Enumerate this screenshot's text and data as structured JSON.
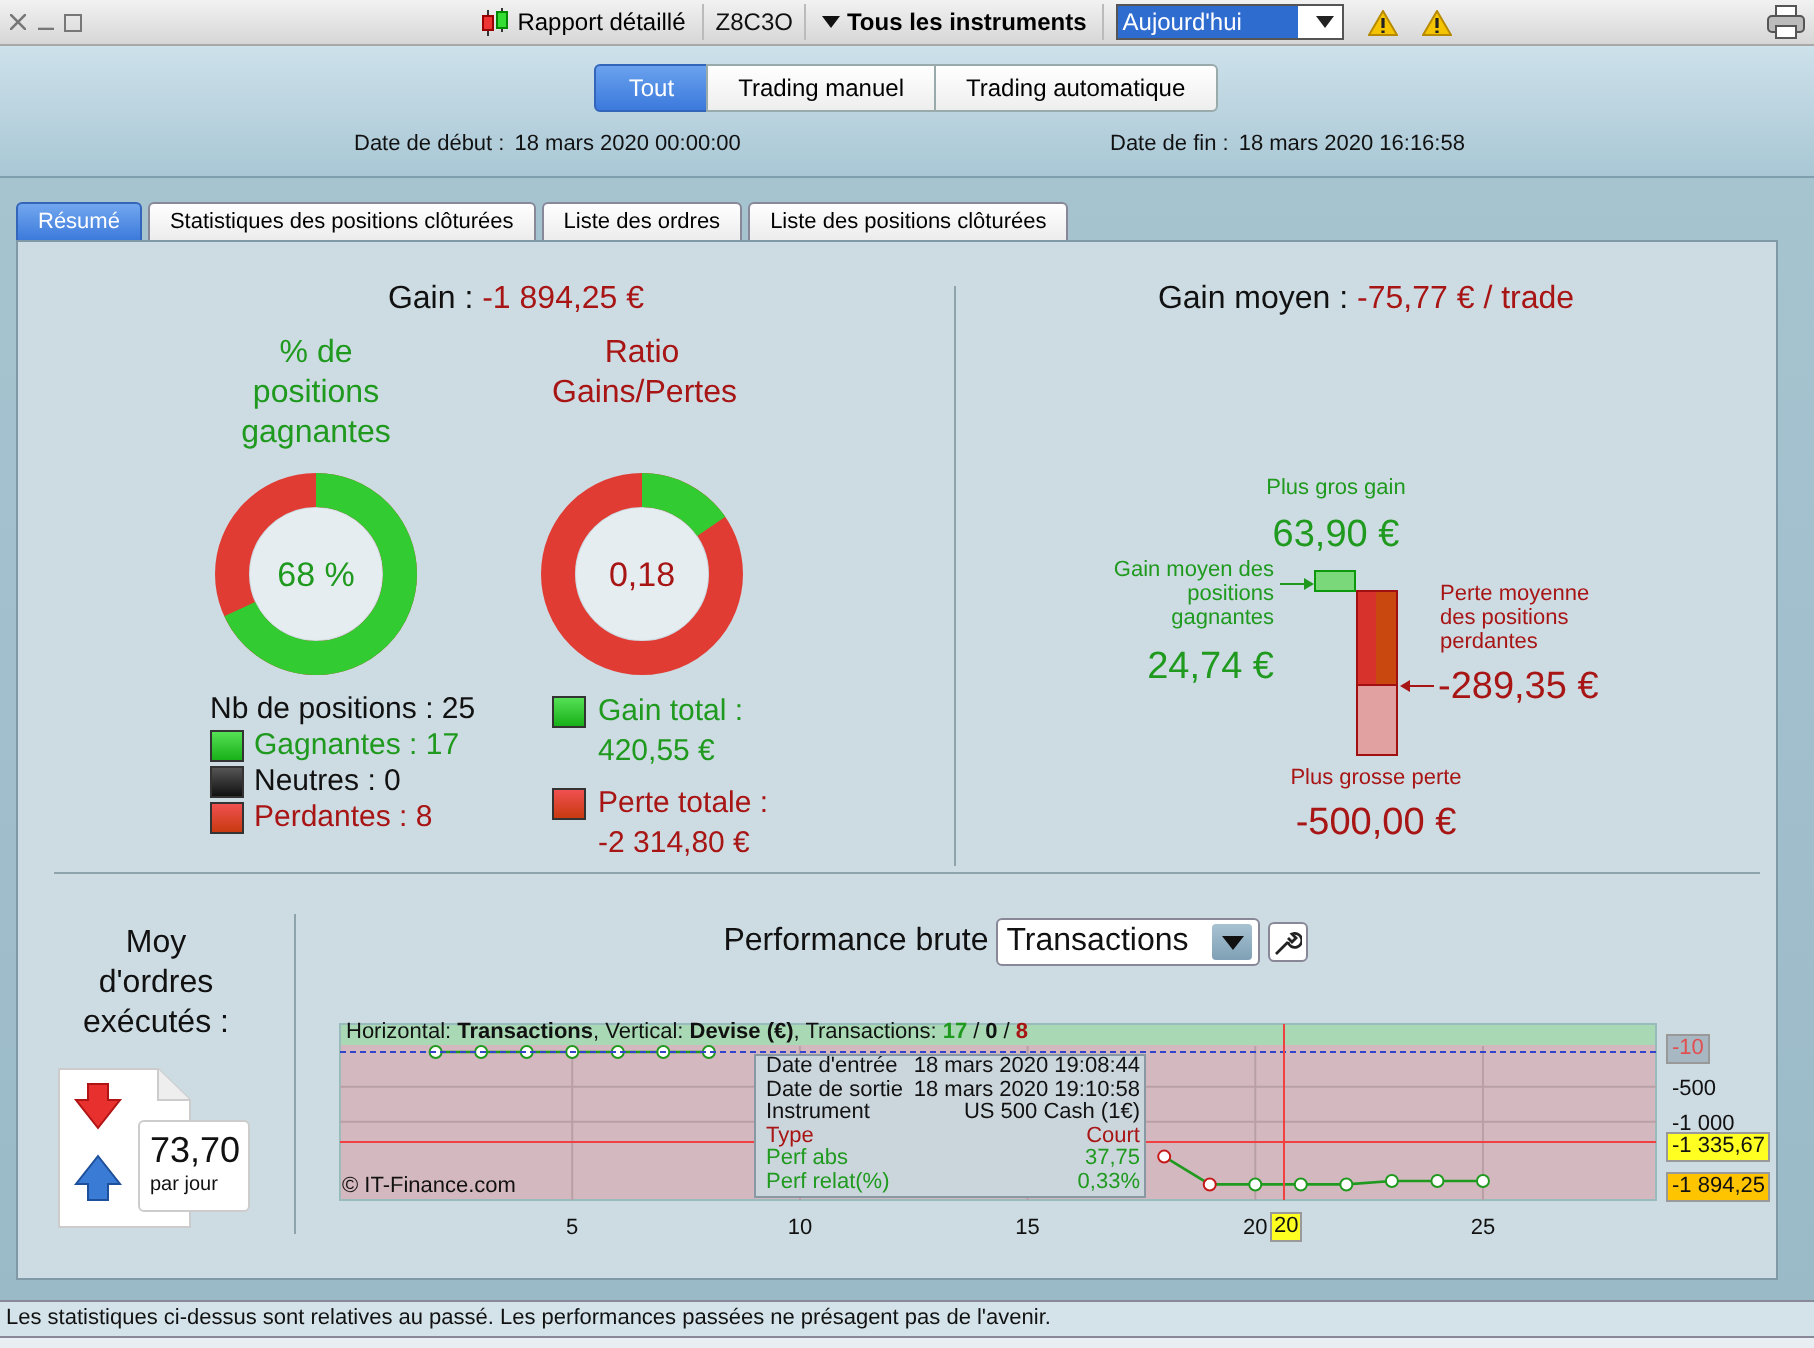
{
  "toolbar": {
    "report_label": "Rapport détaillé",
    "account": "Z8C3O",
    "instruments_label": "Tous les instruments",
    "period": {
      "value": "Aujourd'hui"
    }
  },
  "filters": [
    {
      "label": "Tout",
      "selected": true
    },
    {
      "label": "Trading manuel",
      "selected": false
    },
    {
      "label": "Trading automatique",
      "selected": false
    }
  ],
  "dates": [
    {
      "label": "Date de début :",
      "value": "18 mars 2020 00:00:00"
    },
    {
      "label": "Date de fin :",
      "value": "18 mars 2020 16:16:58"
    }
  ],
  "tabs": [
    {
      "label": "Résumé",
      "selected": true
    },
    {
      "label": "Statistiques des positions clôturées",
      "selected": false
    },
    {
      "label": "Liste des ordres",
      "selected": false
    },
    {
      "label": "Liste des positions clôturées",
      "selected": false
    }
  ],
  "summary": {
    "gain": {
      "label": "Gain :",
      "value": "-1 894,25 €"
    },
    "win_rate": {
      "title": "% de positions gagnantes",
      "value": "68 %",
      "level": 0.68,
      "kind": "win"
    },
    "ratio": {
      "title": "Ratio Gains/Pertes",
      "value": "0,18",
      "level": 0.154,
      "kind": "loss"
    },
    "positions": {
      "label": "Nb de positions : 25",
      "items": [
        {
          "label": "Gagnantes : 17",
          "kind": "win"
        },
        {
          "label": "Neutres : 0",
          "kind": "neutral"
        },
        {
          "label": "Perdantes : 8",
          "kind": "loss"
        }
      ]
    },
    "totals": [
      {
        "label": "Gain total :",
        "value": "420,55 €",
        "kind": "win"
      },
      {
        "label": "Perte totale :",
        "value": "-2 314,80 €",
        "kind": "loss"
      }
    ]
  },
  "average": {
    "label": "Gain moyen :",
    "value": "-75,77 € / trade",
    "max_gain": {
      "label": "Plus gros gain",
      "value": "63,90 €"
    },
    "avg_win": {
      "label": "Gain moyen des positions gagnantes",
      "value": "24,74 €"
    },
    "avg_loss": {
      "label": "Perte moyenne des positions perdantes",
      "value": "-289,35 €"
    },
    "max_loss": {
      "label": "Plus grosse perte",
      "value": "-500,00 €"
    }
  },
  "orders": {
    "title": "Moy d'ordres exécutés :",
    "value": "73,70",
    "unit": "par jour"
  },
  "performance": {
    "title": "Performance brute",
    "mode": {
      "value": "Transactions"
    },
    "legend": {
      "text": "Horizontal: **Transactions**, Vertical: **Devise (€)**, Transactions:",
      "separator": "/",
      "counts": [
        {
          "value": "17",
          "kind": "win"
        },
        {
          "value": "0",
          "kind": "neutral"
        },
        {
          "value": "8",
          "kind": "loss"
        }
      ]
    },
    "watermark": "© IT-Finance.com",
    "tooltip": [
      {
        "label": "Date d'entrée",
        "value": "18 mars 2020 19:08:44",
        "kind": "info"
      },
      {
        "label": "Date de sortie",
        "value": "18 mars 2020 19:10:58",
        "kind": "info"
      },
      {
        "label": "Instrument",
        "value": "US 500 Cash (1€)",
        "kind": "info"
      },
      {
        "label": "Type",
        "value": "Court",
        "kind": "loss"
      },
      {
        "label": "Perf abs",
        "value": "37,75",
        "kind": "win"
      },
      {
        "label": "Perf relat(%)",
        "value": "0,33%",
        "kind": "win"
      }
    ],
    "value_labels": [
      {
        "text": "-10",
        "kind": "top"
      },
      {
        "text": "-1 335,67",
        "kind": "cursor"
      },
      {
        "text": "-1 894,25",
        "kind": "last"
      }
    ],
    "cursor_x_label": "20",
    "chart_data": {
      "type": "line",
      "x": [
        2,
        3,
        4,
        5,
        6,
        7,
        8,
        9,
        10,
        11,
        12,
        13,
        14,
        15,
        16,
        17,
        18,
        19,
        20,
        21,
        22,
        23,
        24,
        25
      ],
      "series": [
        {
          "color": "#1f9a1f",
          "values": [
            0,
            0,
            0,
            0,
            0,
            0,
            0,
            null,
            null,
            null,
            null,
            null,
            null,
            null,
            null,
            null,
            -1500,
            -1900,
            -1900,
            -1900,
            -1900,
            -1850,
            -1850,
            -1850
          ]
        }
      ],
      "xlim": [
        -0.1,
        28.8
      ],
      "ylim": [
        -2123,
        402
      ],
      "grid": true,
      "marker": "o",
      "xticks": [
        5,
        10,
        15,
        20,
        25
      ],
      "yticks": [
        {
          "value": -500,
          "label": "-500"
        },
        {
          "value": -1000,
          "label": "-1 000"
        }
      ]
    }
  },
  "status_bar": "Les statistiques ci-dessus sont relatives au passé. Les performances passées ne présagent pas de l'avenir."
}
